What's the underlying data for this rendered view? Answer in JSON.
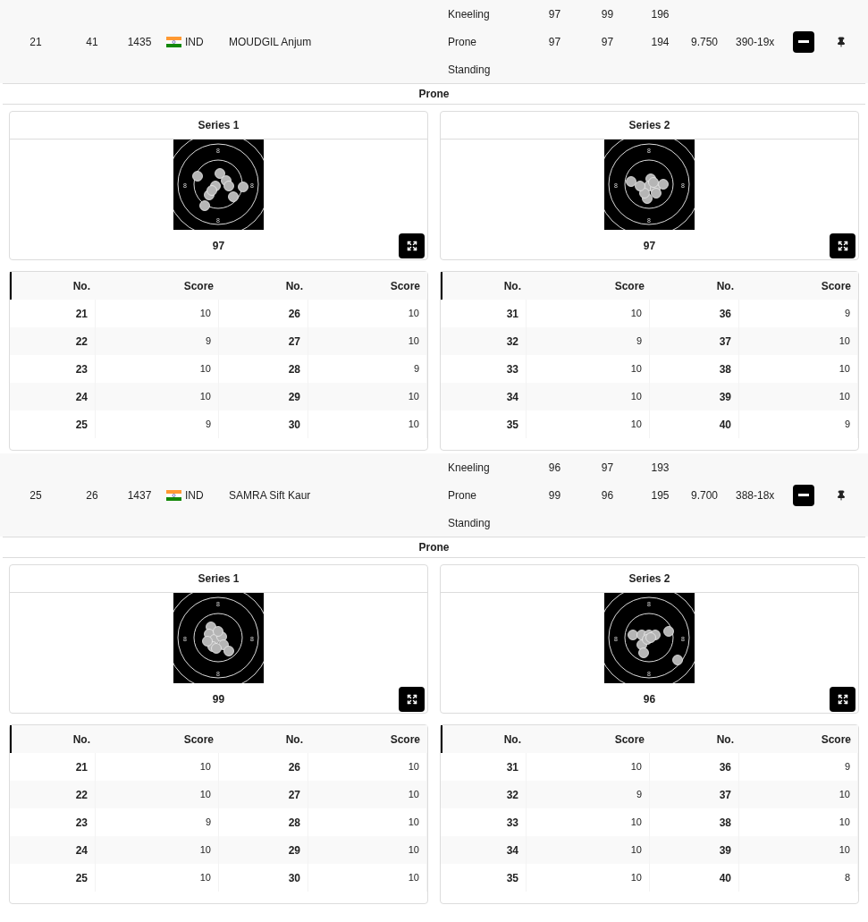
{
  "athletes": [
    {
      "column_1": "21",
      "column_2": "41",
      "column_3": "1435",
      "nation": "IND",
      "name": "MOUDGIL Anjum",
      "stages": [
        {
          "label": "Kneeling",
          "values": [
            "97",
            "99",
            "196"
          ]
        },
        {
          "label": "Prone",
          "values": [
            "97",
            "97",
            "194"
          ]
        },
        {
          "label": "Standing"
        }
      ],
      "average": "9.750",
      "total": "390-19x",
      "expanded": true,
      "detail": {
        "title": "Prone",
        "series": [
          {
            "title": "Series 1",
            "score": "97",
            "ring_labels": [
              "8",
              "8",
              "8",
              "8"
            ],
            "table": {
              "columns": [
                "No.",
                "Score",
                "No.",
                "Score"
              ],
              "rows": [
                [
                  "21",
                  "10",
                  "26",
                  "10"
                ],
                [
                  "22",
                  "9",
                  "27",
                  "10"
                ],
                [
                  "23",
                  "10",
                  "28",
                  "9"
                ],
                [
                  "24",
                  "10",
                  "29",
                  "10"
                ],
                [
                  "25",
                  "9",
                  "30",
                  "10"
                ]
              ]
            }
          },
          {
            "title": "Series 2",
            "score": "97",
            "ring_labels": [
              "8",
              "8",
              "8",
              "8"
            ],
            "table": {
              "columns": [
                "No.",
                "Score",
                "No.",
                "Score"
              ],
              "rows": [
                [
                  "31",
                  "10",
                  "36",
                  "9"
                ],
                [
                  "32",
                  "9",
                  "37",
                  "10"
                ],
                [
                  "33",
                  "10",
                  "38",
                  "10"
                ],
                [
                  "34",
                  "10",
                  "39",
                  "10"
                ],
                [
                  "35",
                  "10",
                  "40",
                  "9"
                ]
              ]
            }
          }
        ]
      }
    },
    {
      "column_1": "25",
      "column_2": "26",
      "column_3": "1437",
      "nation": "IND",
      "name": "SAMRA Sift Kaur",
      "stages": [
        {
          "label": "Kneeling",
          "values": [
            "96",
            "97",
            "193"
          ]
        },
        {
          "label": "Prone",
          "values": [
            "99",
            "96",
            "195"
          ]
        },
        {
          "label": "Standing"
        }
      ],
      "average": "9.700",
      "total": "388-18x",
      "expanded": true,
      "detail": {
        "title": "Prone",
        "series": [
          {
            "title": "Series 1",
            "score": "99",
            "ring_labels": [
              "8",
              "8",
              "8",
              "8"
            ],
            "table": {
              "columns": [
                "No.",
                "Score",
                "No.",
                "Score"
              ],
              "rows": [
                [
                  "21",
                  "10",
                  "26",
                  "10"
                ],
                [
                  "22",
                  "10",
                  "27",
                  "10"
                ],
                [
                  "23",
                  "9",
                  "28",
                  "10"
                ],
                [
                  "24",
                  "10",
                  "29",
                  "10"
                ],
                [
                  "25",
                  "10",
                  "30",
                  "10"
                ]
              ]
            }
          },
          {
            "title": "Series 2",
            "score": "96",
            "ring_labels": [
              "8",
              "8",
              "8",
              "8"
            ],
            "table": {
              "columns": [
                "No.",
                "Score",
                "No.",
                "Score"
              ],
              "rows": [
                [
                  "31",
                  "10",
                  "36",
                  "9"
                ],
                [
                  "32",
                  "9",
                  "37",
                  "10"
                ],
                [
                  "33",
                  "10",
                  "38",
                  "10"
                ],
                [
                  "34",
                  "10",
                  "39",
                  "10"
                ],
                [
                  "35",
                  "10",
                  "40",
                  "8"
                ]
              ]
            }
          }
        ]
      }
    }
  ]
}
